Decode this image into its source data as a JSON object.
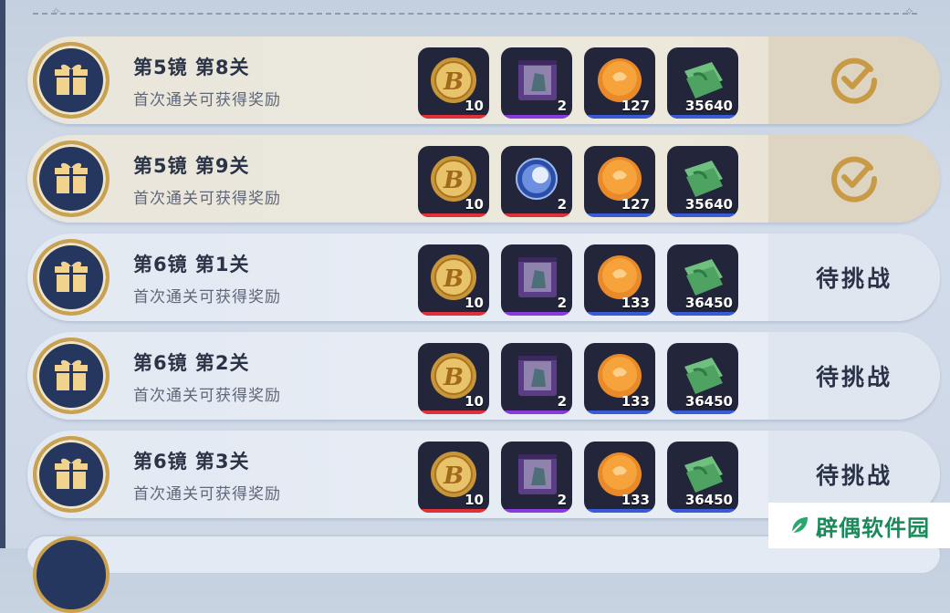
{
  "rows": [
    {
      "title": "第5镜 第8关",
      "subtitle": "首次通关可获得奖励",
      "status": "done",
      "status_label": "",
      "rewards": [
        {
          "icon": "gold-b-coin-icon",
          "qty": "10",
          "rarity_color": "#e0303a"
        },
        {
          "icon": "purple-box-icon",
          "qty": "2",
          "rarity_color": "#8a3be0"
        },
        {
          "icon": "orange-orb-icon",
          "qty": "127",
          "rarity_color": "#3a5bd8"
        },
        {
          "icon": "cash-bundle-icon",
          "qty": "35640",
          "rarity_color": "#3a5bd8"
        }
      ]
    },
    {
      "title": "第5镜 第9关",
      "subtitle": "首次通关可获得奖励",
      "status": "done",
      "status_label": "",
      "rewards": [
        {
          "icon": "gold-b-coin-icon",
          "qty": "10",
          "rarity_color": "#e0303a"
        },
        {
          "icon": "blue-crystal-orb-icon",
          "qty": "2",
          "rarity_color": "#e0303a"
        },
        {
          "icon": "orange-orb-icon",
          "qty": "127",
          "rarity_color": "#3a5bd8"
        },
        {
          "icon": "cash-bundle-icon",
          "qty": "35640",
          "rarity_color": "#3a5bd8"
        }
      ]
    },
    {
      "title": "第6镜 第1关",
      "subtitle": "首次通关可获得奖励",
      "status": "pending",
      "status_label": "待挑战",
      "rewards": [
        {
          "icon": "gold-b-coin-icon",
          "qty": "10",
          "rarity_color": "#e0303a"
        },
        {
          "icon": "purple-box-icon",
          "qty": "2",
          "rarity_color": "#8a3be0"
        },
        {
          "icon": "orange-orb-icon",
          "qty": "133",
          "rarity_color": "#3a5bd8"
        },
        {
          "icon": "cash-bundle-icon",
          "qty": "36450",
          "rarity_color": "#3a5bd8"
        }
      ]
    },
    {
      "title": "第6镜 第2关",
      "subtitle": "首次通关可获得奖励",
      "status": "pending",
      "status_label": "待挑战",
      "rewards": [
        {
          "icon": "gold-b-coin-icon",
          "qty": "10",
          "rarity_color": "#e0303a"
        },
        {
          "icon": "purple-box-icon",
          "qty": "2",
          "rarity_color": "#8a3be0"
        },
        {
          "icon": "orange-orb-icon",
          "qty": "133",
          "rarity_color": "#3a5bd8"
        },
        {
          "icon": "cash-bundle-icon",
          "qty": "36450",
          "rarity_color": "#3a5bd8"
        }
      ]
    },
    {
      "title": "第6镜 第3关",
      "subtitle": "首次通关可获得奖励",
      "status": "pending",
      "status_label": "待挑战",
      "rewards": [
        {
          "icon": "gold-b-coin-icon",
          "qty": "10",
          "rarity_color": "#e0303a"
        },
        {
          "icon": "purple-box-icon",
          "qty": "2",
          "rarity_color": "#8a3be0"
        },
        {
          "icon": "orange-orb-icon",
          "qty": "133",
          "rarity_color": "#3a5bd8"
        },
        {
          "icon": "cash-bundle-icon",
          "qty": "36450",
          "rarity_color": "#3a5bd8"
        }
      ]
    }
  ],
  "watermark": {
    "text": "辟偶软件园"
  },
  "colors": {
    "badge_bg": "#25365f",
    "badge_border": "#caa24f",
    "check": "#c99a45",
    "text_dark": "#2a3247"
  }
}
